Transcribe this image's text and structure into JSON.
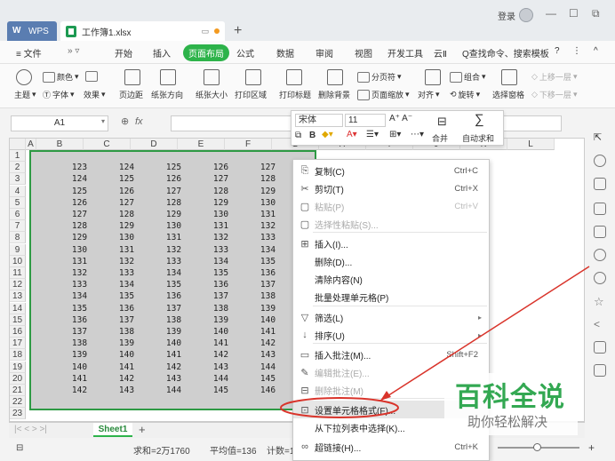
{
  "titlebar": {
    "wps_tab": "WPS",
    "doc_tab": "工作簿1.xlsx",
    "new_tab": "+",
    "login": "登录",
    "min": "—",
    "max": "☐",
    "restore": "⧉"
  },
  "ribbon_tabs": {
    "menu": "≡ 文件",
    "items": [
      "开始",
      "插入",
      "页面布局",
      "公式",
      "数据",
      "审阅",
      "视图",
      "开发工具",
      "云Ⅱ"
    ],
    "active": "页面布局",
    "search": "Q查找命令、搜索模板",
    "help": "?",
    "more": "⋮",
    "collapse": "^"
  },
  "ribbon": {
    "theme": "主题",
    "color": "颜色",
    "font": "字体",
    "effect": "效果",
    "margins": "页边距",
    "orientation": "纸张方向",
    "size": "纸张大小",
    "print_area": "打印区域",
    "print_titles": "打印标题",
    "delete_bg": "删除背景",
    "page_break": "分页符",
    "page_zoom": "页面缩放",
    "align": "对齐",
    "group": "组合",
    "rotate": "旋转",
    "selection_pane": "选择窗格",
    "bring_forward": "上移一层",
    "send_backward": "下移一层"
  },
  "formula_bar": {
    "name_box": "A1",
    "fx": "fx"
  },
  "grid": {
    "columns": [
      "A",
      "B",
      "C",
      "D",
      "E",
      "F",
      "G",
      "H",
      "I",
      "J",
      "K",
      "L"
    ],
    "rows": [
      "1",
      "2",
      "3",
      "4",
      "5",
      "6",
      "7",
      "8",
      "9",
      "10",
      "11",
      "12",
      "13",
      "14",
      "15",
      "16",
      "17",
      "18",
      "19",
      "20",
      "21",
      "22",
      "23"
    ],
    "data": [
      [
        "123",
        "124",
        "125",
        "126",
        "127"
      ],
      [
        "124",
        "125",
        "126",
        "127",
        "128"
      ],
      [
        "125",
        "126",
        "127",
        "128",
        "129"
      ],
      [
        "126",
        "127",
        "128",
        "129",
        "130"
      ],
      [
        "127",
        "128",
        "129",
        "130",
        "131"
      ],
      [
        "128",
        "129",
        "130",
        "131",
        "132"
      ],
      [
        "129",
        "130",
        "131",
        "132",
        "133"
      ],
      [
        "130",
        "131",
        "132",
        "133",
        "134"
      ],
      [
        "131",
        "132",
        "133",
        "134",
        "135"
      ],
      [
        "132",
        "133",
        "134",
        "135",
        "136"
      ],
      [
        "133",
        "134",
        "135",
        "136",
        "137"
      ],
      [
        "134",
        "135",
        "136",
        "137",
        "138"
      ],
      [
        "135",
        "136",
        "137",
        "138",
        "139"
      ],
      [
        "136",
        "137",
        "138",
        "139",
        "140"
      ],
      [
        "137",
        "138",
        "139",
        "140",
        "141"
      ],
      [
        "138",
        "139",
        "140",
        "141",
        "142"
      ],
      [
        "139",
        "140",
        "141",
        "142",
        "143"
      ],
      [
        "140",
        "141",
        "142",
        "143",
        "144"
      ],
      [
        "141",
        "142",
        "143",
        "144",
        "145"
      ],
      [
        "142",
        "143",
        "144",
        "145",
        "146"
      ]
    ]
  },
  "sheet_tabs": {
    "active": "Sheet1",
    "add": "+"
  },
  "status": {
    "sum": "求和=2万1760",
    "avg": "平均值=136",
    "count": "计数=160"
  },
  "mini_toolbar": {
    "font": "宋体",
    "size": "11",
    "bold": "B",
    "merge": "合并",
    "autosum": "自动求和"
  },
  "context_menu": {
    "items": [
      {
        "label": "复制(C)",
        "shortcut": "Ctrl+C",
        "icon": "copy-icon"
      },
      {
        "label": "剪切(T)",
        "shortcut": "Ctrl+X",
        "icon": "cut-icon"
      },
      {
        "label": "粘贴(P)",
        "shortcut": "Ctrl+V",
        "icon": "paste-icon"
      },
      {
        "label": "选择性粘贴(S)...",
        "shortcut": "",
        "icon": "paste-special-icon"
      },
      {
        "label": "插入(I)...",
        "shortcut": "",
        "icon": "insert-icon"
      },
      {
        "label": "删除(D)...",
        "shortcut": "",
        "icon": ""
      },
      {
        "label": "清除内容(N)",
        "shortcut": "",
        "icon": ""
      },
      {
        "label": "批量处理单元格(P)",
        "shortcut": "",
        "icon": ""
      },
      {
        "label": "筛选(L)",
        "shortcut": "",
        "icon": "filter-icon"
      },
      {
        "label": "排序(U)",
        "shortcut": "",
        "icon": "sort-icon"
      },
      {
        "label": "插入批注(M)...",
        "shortcut": "Shift+F2",
        "icon": "comment-icon"
      },
      {
        "label": "编辑批注(E)...",
        "shortcut": "",
        "icon": "edit-comment-icon"
      },
      {
        "label": "删除批注(M)",
        "shortcut": "",
        "icon": "delete-comment-icon"
      },
      {
        "label": "设置单元格格式(F)...",
        "shortcut": "",
        "icon": "format-cells-icon"
      },
      {
        "label": "从下拉列表中选择(K)...",
        "shortcut": "",
        "icon": ""
      },
      {
        "label": "超链接(H)...",
        "shortcut": "Ctrl+K",
        "icon": "link-icon"
      }
    ]
  },
  "watermark": {
    "title": "百科全说",
    "subtitle": "助你轻松解决"
  },
  "colors": {
    "accent": "#2db34a",
    "selection_border": "#2e9a44",
    "annotation": "#d9342b",
    "watermark_green": "#33a852"
  }
}
